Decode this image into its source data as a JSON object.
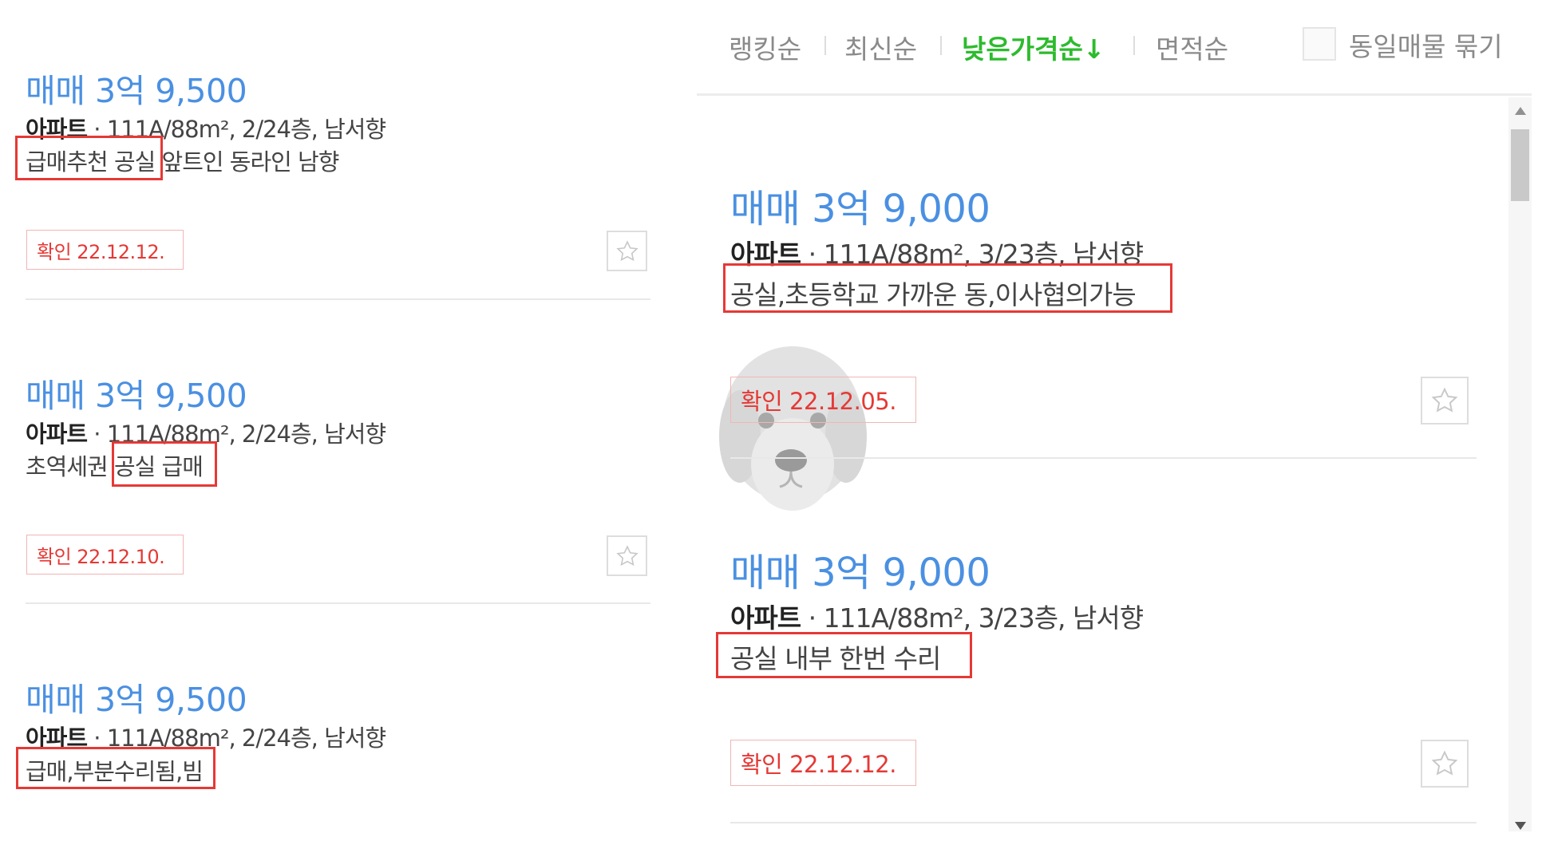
{
  "sort_bar": {
    "options": [
      "랭킹순",
      "최신순",
      "낮은가격순↓",
      "면적순"
    ],
    "same_listing_label": "동일매물 묶기"
  },
  "left_listings": [
    {
      "price": "매매 3억 9,500",
      "type": "아파트",
      "spec": " · 111A/88m², 2/24층, 남서향",
      "desc": "급매추천 공실 앞트인 동라인 남향",
      "confirm": "확인 22.12.12."
    },
    {
      "price": "매매 3억 9,500",
      "type": "아파트",
      "spec": " · 111A/88m², 2/24층, 남서향",
      "desc": "초역세권 공실 급매",
      "confirm": "확인 22.12.10."
    },
    {
      "price": "매매 3억 9,500",
      "type": "아파트",
      "spec": " · 111A/88m², 2/24층, 남서향",
      "desc": "급매,부분수리됨,빔"
    }
  ],
  "right_listings": [
    {
      "price": "매매 3억 9,000",
      "type": "아파트",
      "spec": " · 111A/88m², 3/23층, 남서향",
      "desc": "공실,초등학교 가까운 동,이사협의가능",
      "confirm": "확인 22.12.05."
    },
    {
      "price": "매매 3억 9,000",
      "type": "아파트",
      "spec": " · 111A/88m², 3/23층, 남서향",
      "desc": "공실 내부 한번 수리",
      "confirm": "확인 22.12.12."
    }
  ],
  "colors": {
    "price": "#4a90e2",
    "highlight": "#e53935",
    "active_sort": "#2dbb2d"
  },
  "icons": [
    "star-icon",
    "scroll-up-icon",
    "scroll-down-icon",
    "puppy-watermark"
  ]
}
